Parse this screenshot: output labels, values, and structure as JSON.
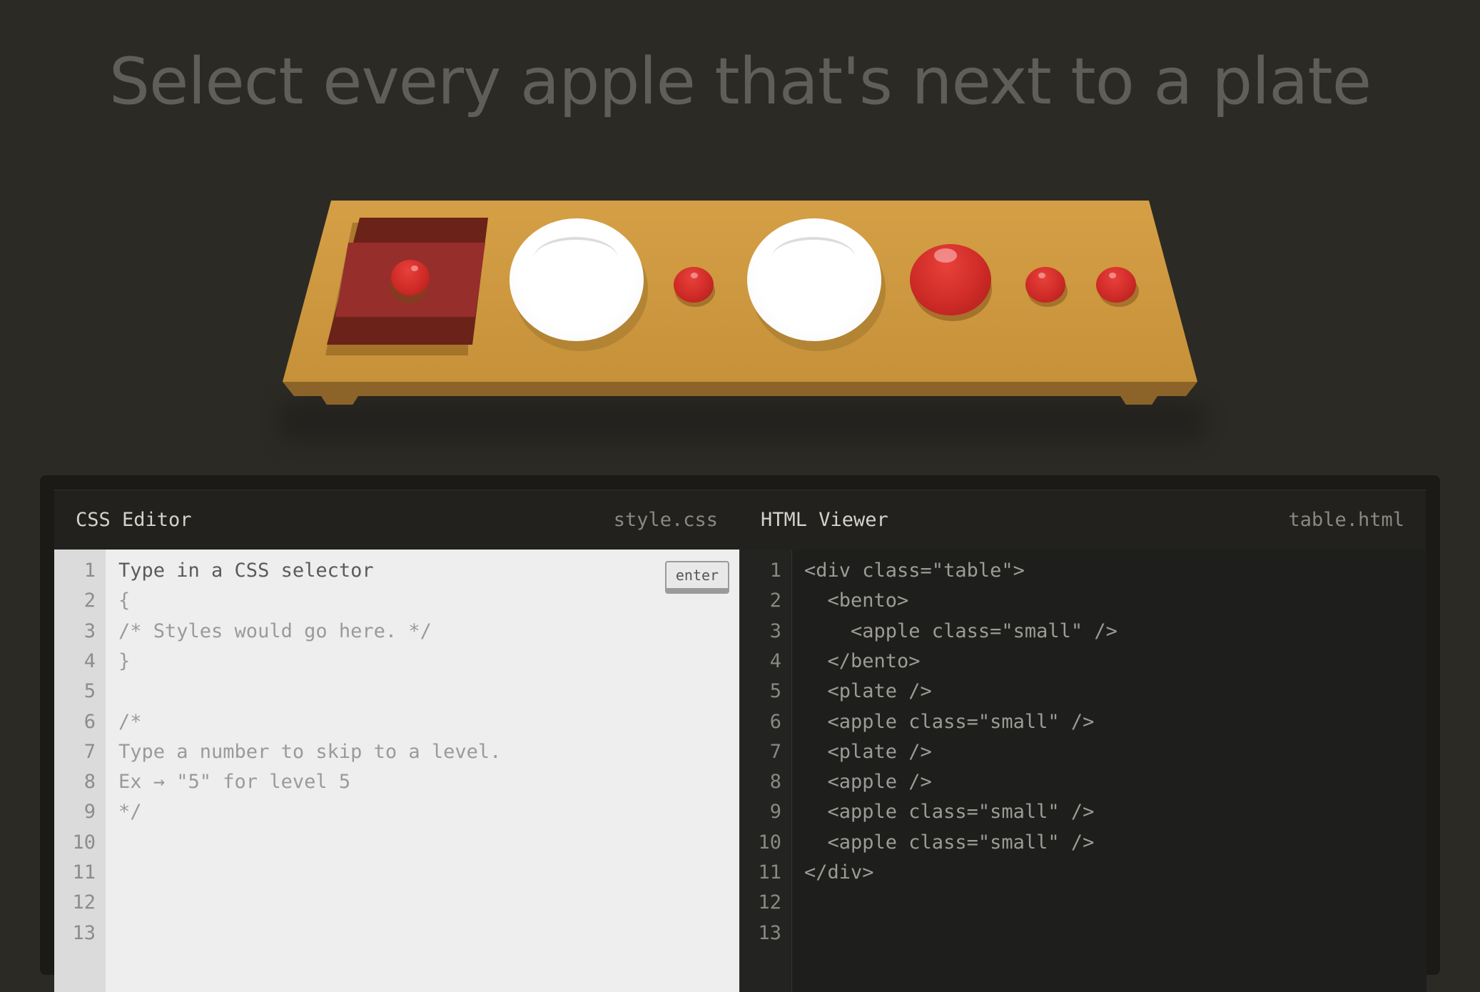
{
  "instruction": "Select every apple that's next to a plate",
  "css_editor": {
    "title": "CSS Editor",
    "filename": "style.css",
    "enter_label": "enter",
    "lines": [
      "Type in a CSS selector",
      "{",
      "/* Styles would go here. */",
      "}",
      "",
      "/*",
      "Type a number to skip to a level.",
      "Ex → \"5\" for level 5",
      "*/",
      "",
      "",
      "",
      ""
    ]
  },
  "html_viewer": {
    "title": "HTML Viewer",
    "filename": "table.html",
    "lines": [
      "<div class=\"table\">",
      "  <bento>",
      "    <apple class=\"small\" />",
      "  </bento>",
      "  <plate />",
      "  <apple class=\"small\" />",
      "  <plate />",
      "  <apple />",
      "  <apple class=\"small\" />",
      "  <apple class=\"small\" />",
      "</div>",
      "",
      ""
    ]
  },
  "line_numbers": [
    "1",
    "2",
    "3",
    "4",
    "5",
    "6",
    "7",
    "8",
    "9",
    "10",
    "11",
    "12",
    "13"
  ],
  "table_items": [
    "bento-with-small-apple",
    "plate",
    "small-apple",
    "plate",
    "apple",
    "small-apple",
    "small-apple"
  ]
}
